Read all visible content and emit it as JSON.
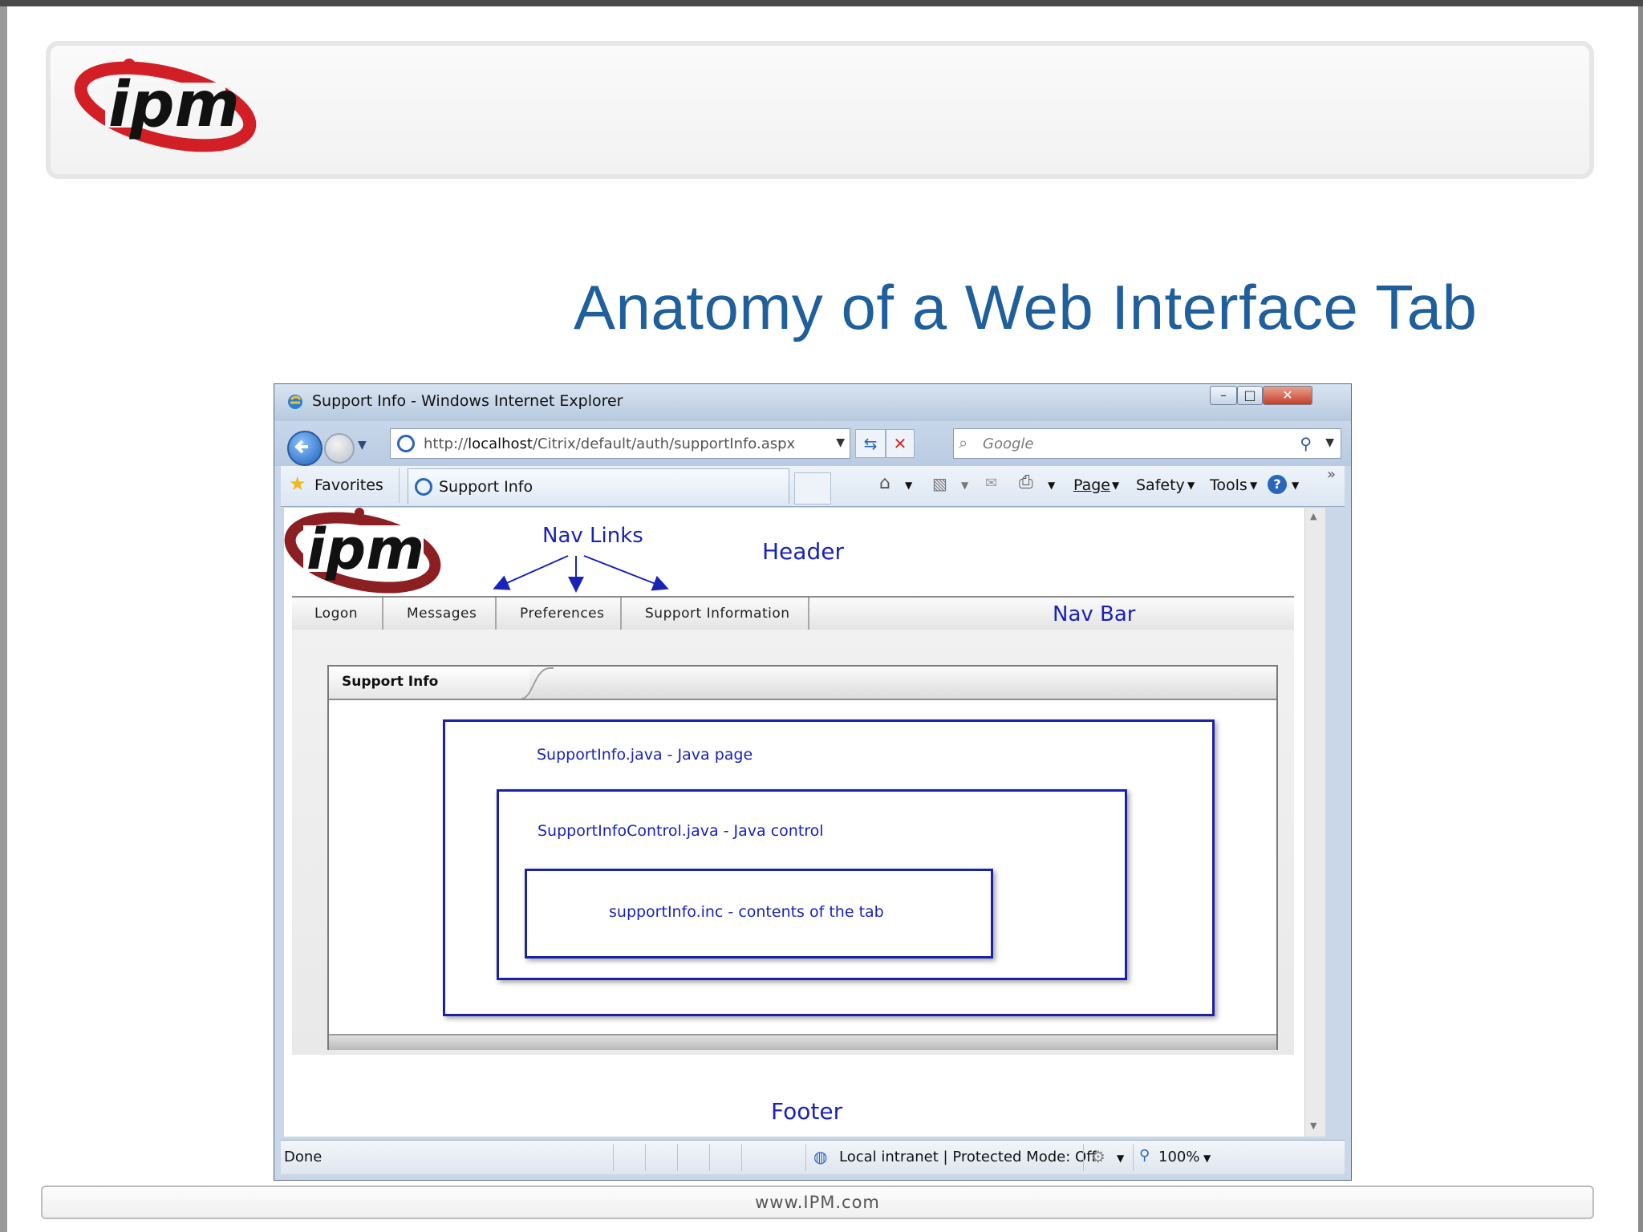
{
  "slide": {
    "title": "Anatomy of a Web Interface Tab",
    "footer_url": "www.IPM.com",
    "logo_text": "ipm"
  },
  "browser": {
    "window_title": "Support Info - Windows Internet Explorer",
    "address_prefix": "http://",
    "address_host": "localhost",
    "address_path": "/Citrix/default/auth/supportInfo.aspx",
    "search_placeholder": "Google",
    "favorites_label": "Favorites",
    "tab_label": "Support Info",
    "commands": [
      "Page",
      "Safety",
      "Tools"
    ],
    "status_left": "Done",
    "status_zone": "Local intranet | Protected Mode: Off",
    "zoom": "100%"
  },
  "webpage": {
    "logo_text": "ipm",
    "nav_items": [
      "Logon",
      "Messages",
      "Preferences",
      "Support Information"
    ],
    "tab_title": "Support Info"
  },
  "annotations": {
    "nav_links": "Nav Links",
    "header": "Header",
    "nav_bar": "Nav Bar",
    "footer": "Footer",
    "java_page": "SupportInfo.java - Java page",
    "java_control": "SupportInfoControl.java - Java control",
    "tab_contents": "supportInfo.inc - contents of the tab"
  },
  "colors": {
    "title_blue": "#1f5f9c",
    "annotation_blue": "#1a22b8",
    "logo_red": "#d21f26"
  }
}
